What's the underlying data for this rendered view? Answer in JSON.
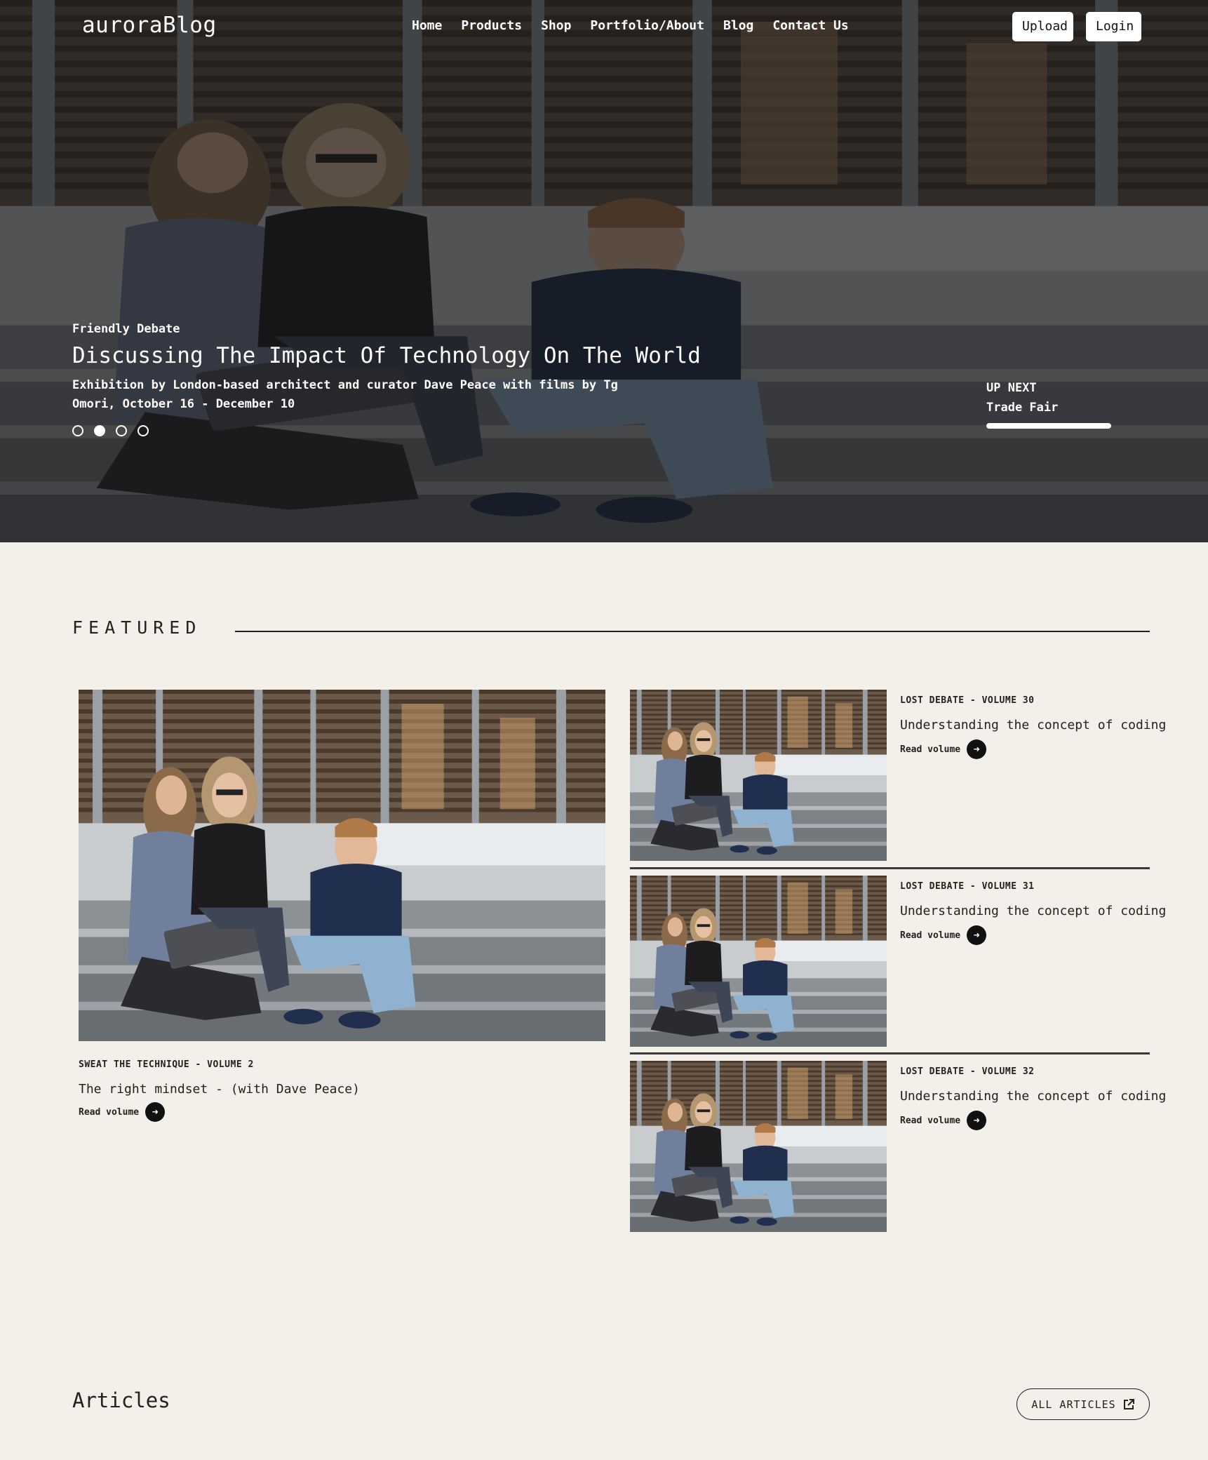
{
  "header": {
    "logo": "auroraBlog",
    "nav": [
      "Home",
      "Products",
      "Shop",
      "Portfolio/About",
      "Blog",
      "Contact Us"
    ],
    "upload_label": "Upload",
    "login_label": "Login"
  },
  "hero": {
    "kicker": "Friendly Debate",
    "title": "Discussing The Impact Of Technology On The World",
    "description": "Exhibition by London-based architect and curator Dave Peace with films by Tg Omori, October 16 - December 10",
    "slides": 4,
    "active_slide": 2,
    "up_next_label": "UP NEXT",
    "up_next_title": "Trade Fair",
    "up_next_progress": 1.0
  },
  "featured": {
    "heading": "FEATURED",
    "main": {
      "kicker": "SWEAT THE TECHNIQUE - VOLUME 2",
      "title": "The right mindset - (with Dave Peace)",
      "read_label": "Read volume"
    },
    "side": [
      {
        "kicker": "LOST DEBATE - VOLUME 30",
        "title": "Understanding the concept of coding",
        "read_label": "Read volume"
      },
      {
        "kicker": "LOST DEBATE - VOLUME 31",
        "title": "Understanding the concept of coding",
        "read_label": "Read volume"
      },
      {
        "kicker": "LOST DEBATE - VOLUME 32",
        "title": "Understanding the concept of coding",
        "read_label": "Read volume"
      }
    ]
  },
  "articles": {
    "title": "Articles",
    "all_label": "ALL ARTICLES"
  },
  "icons": {
    "read": "arrow-right-icon",
    "all_articles": "external-link-icon"
  },
  "colors": {
    "page_background": "#f3f0ea",
    "text": "#1e1e1e",
    "button_dark": "#111111"
  }
}
